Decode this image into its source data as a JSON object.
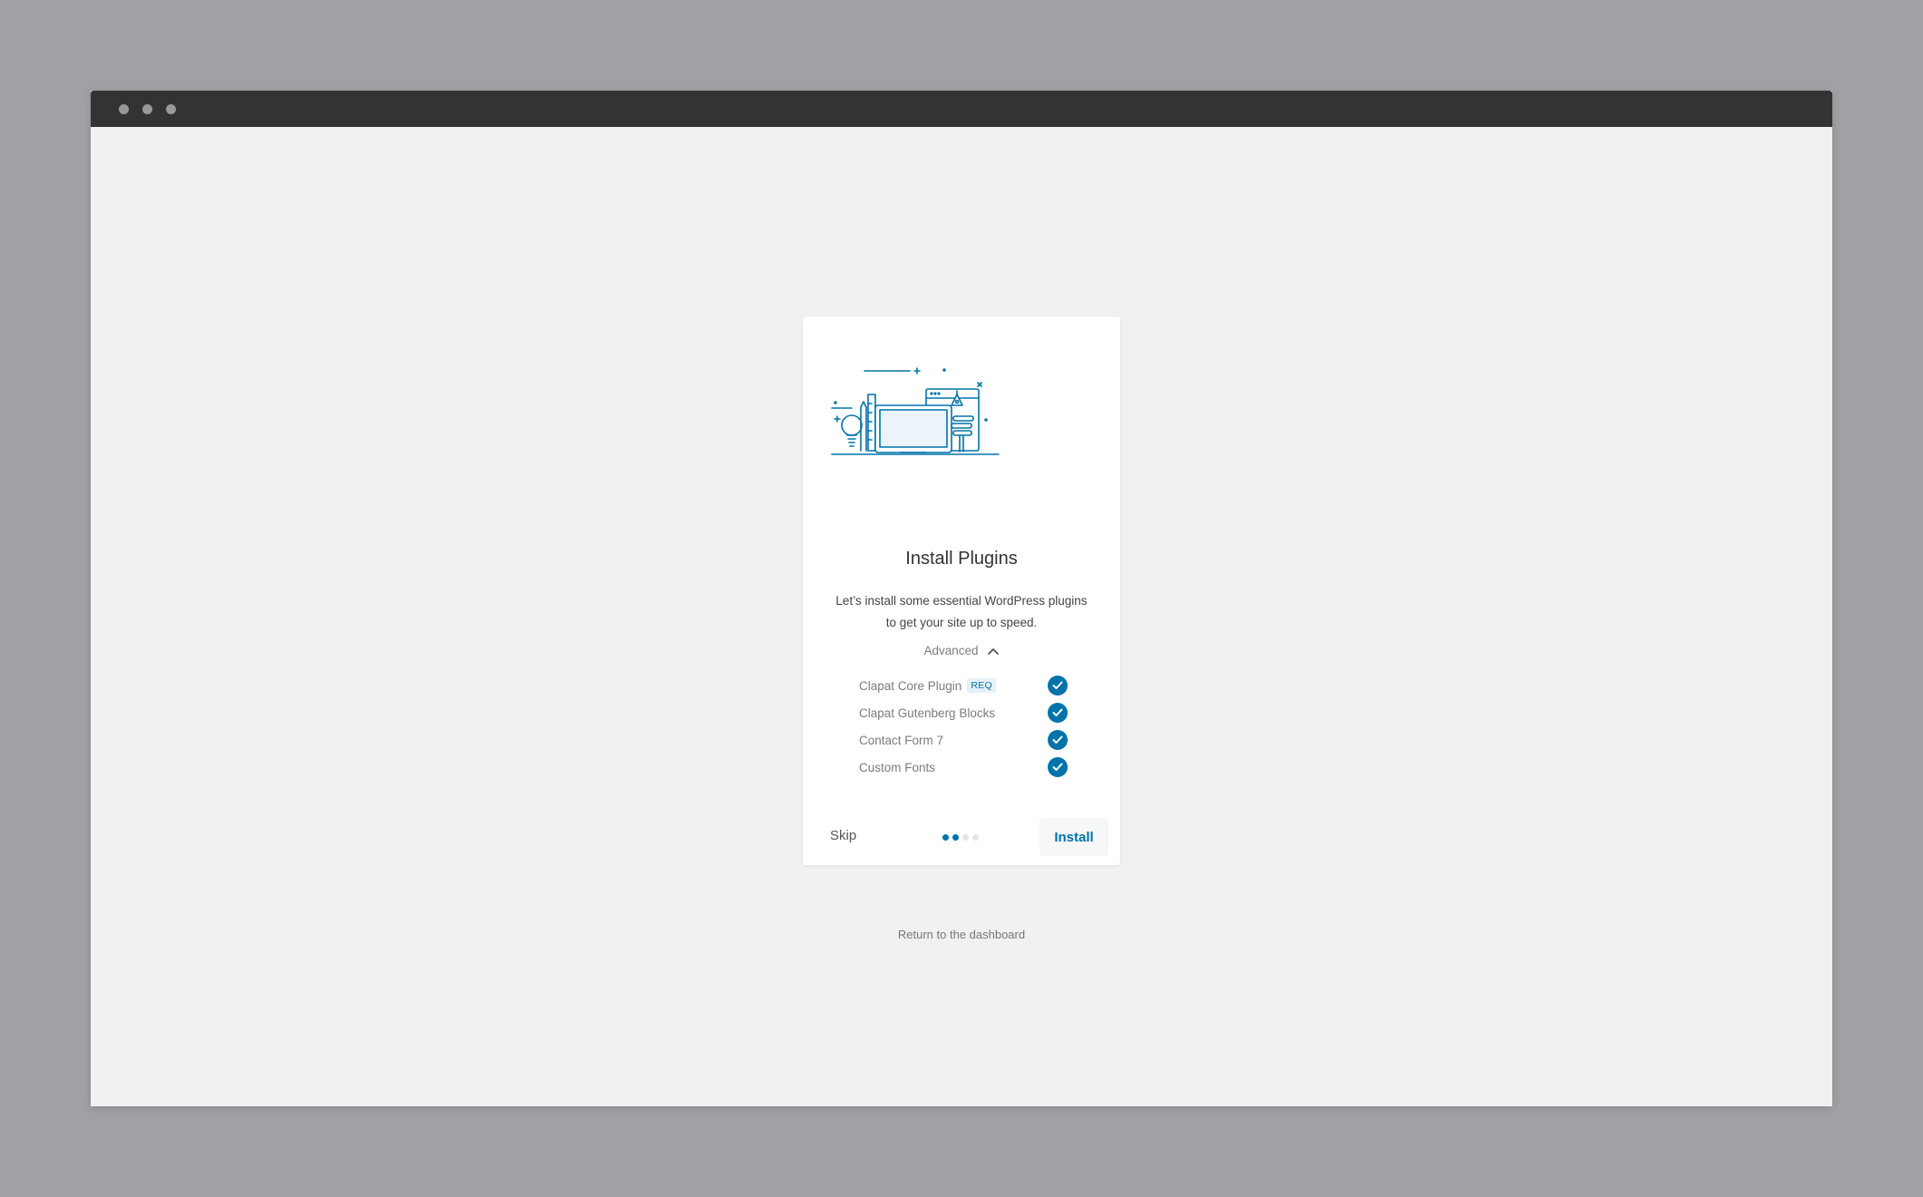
{
  "window": {
    "titlebar_dots": 3
  },
  "card": {
    "illustration_icon": "workspace-illustration",
    "title": "Install Plugins",
    "description": "Let’s install some essential WordPress plugins to get your site up to speed.",
    "advanced_label": "Advanced",
    "plugins": [
      {
        "label": "Clapat Core Plugin",
        "badge": "REQ",
        "checked": true
      },
      {
        "label": "Clapat Gutenberg Blocks",
        "badge": "",
        "checked": true
      },
      {
        "label": "Contact Form 7",
        "badge": "",
        "checked": true
      },
      {
        "label": "Custom Fonts",
        "badge": "",
        "checked": true
      }
    ],
    "skip_label": "Skip",
    "install_label": "Install",
    "steps_total": 4,
    "steps_completed": 2
  },
  "return_link": "Return to the dashboard",
  "colors": {
    "accent": "#0073aa",
    "page_bg": "#f1f1f1",
    "outer_bg": "#a0a1a6",
    "titlebar": "#333333"
  }
}
